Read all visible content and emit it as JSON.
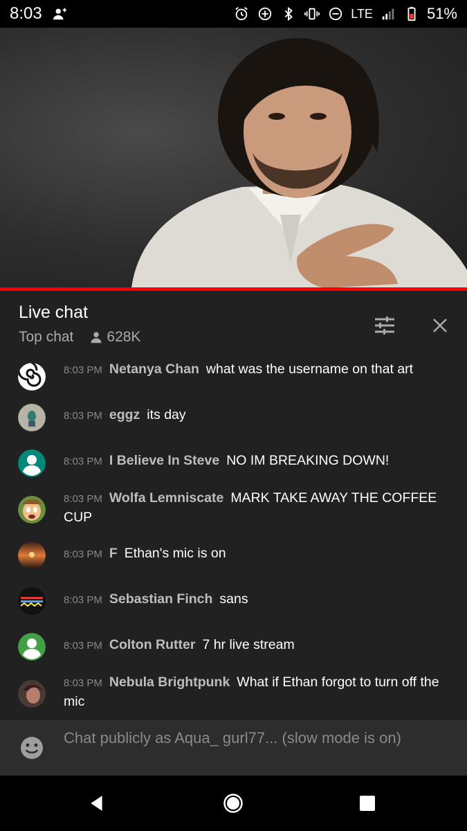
{
  "status_bar": {
    "time": "8:03",
    "network": "LTE",
    "battery": "51%",
    "icons": [
      "add-person-icon",
      "alarm-icon",
      "data-saver-icon",
      "bluetooth-icon",
      "vibrate-icon",
      "do-not-disturb-icon",
      "signal-icon",
      "battery-icon"
    ]
  },
  "video": {
    "progress": 1.0,
    "progress_color": "#ff0000"
  },
  "chat_header": {
    "title": "Live chat",
    "mode": "Top chat",
    "viewers": "628K"
  },
  "messages": [
    {
      "time": "8:03 PM",
      "author": "Netanya Chan",
      "text": "what was the username on that art",
      "avatar": "spiral"
    },
    {
      "time": "8:03 PM",
      "author": "eggz",
      "text": "its day",
      "avatar": "figure"
    },
    {
      "time": "8:03 PM",
      "author": "I Believe In Steve",
      "text": "NO IM BREAKING DOWN!",
      "avatar": "default-teal"
    },
    {
      "time": "8:03 PM",
      "author": "Wolfa Lemniscate",
      "text": "MARK TAKE AWAY THE COFFEE CUP",
      "avatar": "cartoon"
    },
    {
      "time": "8:03 PM",
      "author": "F",
      "text": "Ethan's mic is on",
      "avatar": "sunset"
    },
    {
      "time": "8:03 PM",
      "author": "Sebastian Finch",
      "text": "sans",
      "avatar": "zigzag"
    },
    {
      "time": "8:03 PM",
      "author": "Colton Rutter",
      "text": "7 hr live stream",
      "avatar": "default-green"
    },
    {
      "time": "8:03 PM",
      "author": "Nebula Brightpunk",
      "text": "What if Ethan forgot to turn off the mic",
      "avatar": "photo"
    }
  ],
  "chat_input": {
    "placeholder": "Chat publicly as Aqua_ gurl77... (slow mode is on)"
  },
  "colors": {
    "background": "#212121",
    "accent": "#ff0000",
    "author": "#bdbdbd",
    "timestamp": "#888888"
  }
}
